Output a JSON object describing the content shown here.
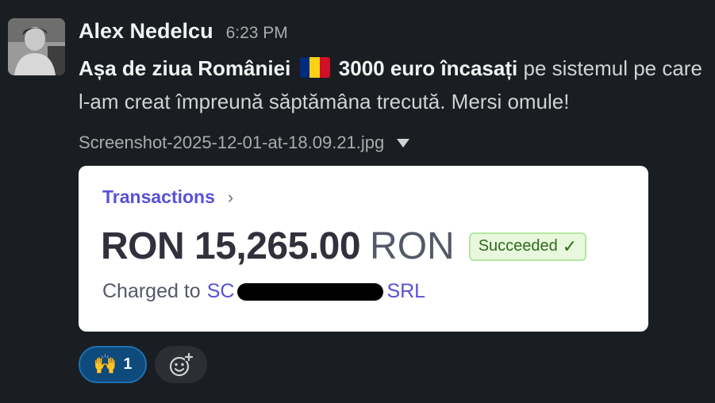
{
  "message": {
    "author": "Alex Nedelcu",
    "time": "6:23 PM",
    "text_bold_1": "Așa de ziua României",
    "text_bold_2": "3000 euro încasați",
    "text_rest": "pe sistemul pe care l-am creat împreună săptămâna trecută. Mersi omule!",
    "flag_colors": [
      "#002b7f",
      "#fcd116",
      "#ce1126"
    ]
  },
  "attachment": {
    "filename": "Screenshot-2025-12-01-at-18.09.21.jpg"
  },
  "card": {
    "title": "Transactions",
    "chevron": "›",
    "amount": "RON 15,265.00",
    "currency": "RON",
    "status": "Succeeded",
    "status_icon": "✓",
    "charged_label": "Charged to",
    "charged_prefix": "SC",
    "charged_suffix": "SRL"
  },
  "reactions": [
    {
      "emoji": "🙌",
      "count": "1"
    }
  ],
  "add_reaction_icon": "smiley-plus-icon",
  "colors": {
    "background": "#1a1d21",
    "accent_link": "#5851d6",
    "success": "#2f6a1d"
  }
}
